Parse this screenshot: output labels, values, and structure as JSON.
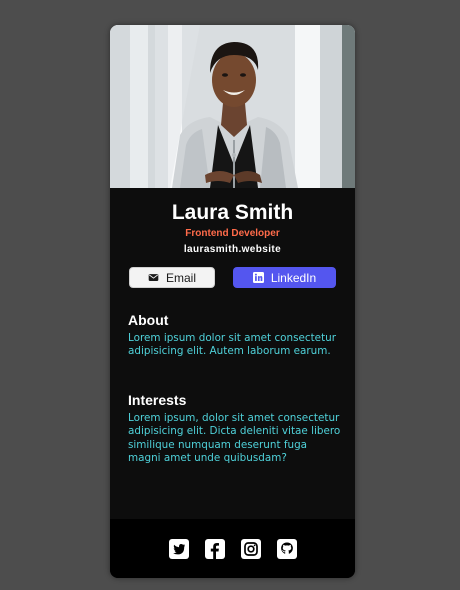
{
  "profile": {
    "name": "Laura Smith",
    "title": "Frontend Developer",
    "website": "laurasmith.website"
  },
  "buttons": {
    "email_label": "Email",
    "linkedin_label": "LinkedIn"
  },
  "about": {
    "heading": "About",
    "text": "Lorem ipsum dolor sit amet consectetur adipisicing elit. Autem laborum earum."
  },
  "interests": {
    "heading": "Interests",
    "text": "Lorem ipsum, dolor sit amet consectetur adipisicing elit. Dicta deleniti vitae libero similique numquam deserunt fuga magni amet unde quibusdam?"
  },
  "footer": {
    "icons": [
      "twitter-icon",
      "facebook-icon",
      "instagram-icon",
      "github-icon"
    ]
  },
  "colors": {
    "card_bg": "#0d0d0d",
    "accent_title": "#f3bf99",
    "body_text": "#4fd1d9",
    "linkedin_blue": "#5456ef",
    "footer_bg": "#000000"
  }
}
